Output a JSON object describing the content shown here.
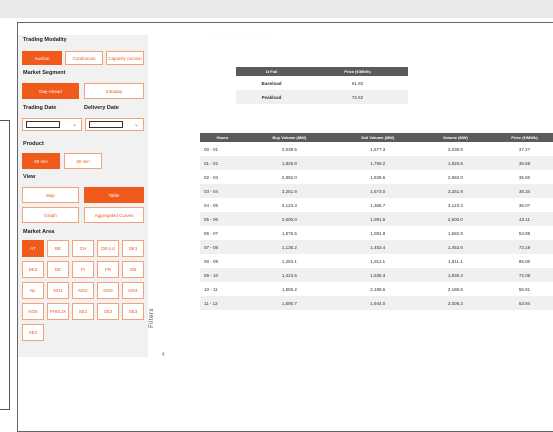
{
  "sidebar": {
    "trading_modality_label": "Trading Modality",
    "modality_buttons": [
      "Auction",
      "Continuous",
      "Capacity Auction"
    ],
    "market_segment_label": "Market Segment",
    "segment_buttons": [
      "Day-Ahead",
      "Intraday"
    ],
    "trading_date_label": "Trading Date",
    "delivery_date_label": "Delivery Date",
    "product_label": "Product",
    "product_buttons": [
      "60 min",
      "30 min"
    ],
    "view_label": "View",
    "view_buttons": [
      "Map",
      "Table",
      "Graph",
      "Aggregated Curves"
    ],
    "market_area_label": "Market Area",
    "market_areas": [
      [
        "AT",
        "BE",
        "CH",
        "DE-LU",
        "DK1"
      ],
      [
        "DK2",
        "EE",
        "FI",
        "FR",
        "GB"
      ],
      [
        "NL",
        "NO1",
        "NO2",
        "NO3",
        "NO4"
      ],
      [
        "NO5",
        "PHELIX",
        "SE1",
        "SE2",
        "SE3"
      ],
      [
        "SE4"
      ]
    ]
  },
  "filters_label": "Filters",
  "faint_heading": "· · · · · · · · ·",
  "summary_table": {
    "headers": [
      "1t Full",
      "Price (€/MWh)"
    ],
    "rows": [
      [
        "Baseload",
        "61.92"
      ],
      [
        "Peakload",
        "72.62"
      ]
    ]
  },
  "hourly_table": {
    "headers": [
      "Hours",
      "Buy Volume (MW)",
      "Sell Volume (MW)",
      "Volume (MW)",
      "Price (€/MWh)"
    ],
    "rows": [
      [
        "00 - 01",
        "2,038.5",
        "1,677.3",
        "2,038.5",
        "37.27"
      ],
      [
        "01 - 02",
        "1,826.8",
        "1,759.2",
        "1,826.8",
        "35.69"
      ],
      [
        "02 - 03",
        "2,882.0",
        "1,839.6",
        "2,882.0",
        "35.60"
      ],
      [
        "03 - 04",
        "3,251.9",
        "1,673.0",
        "3,251.9",
        "35.34"
      ],
      [
        "04 - 05",
        "3,123.3",
        "1,366.7",
        "3,123.3",
        "36.07"
      ],
      [
        "05 - 06",
        "2,600.0",
        "1,091.5",
        "2,600.0",
        "43.11"
      ],
      [
        "06 - 07",
        "1,575.5",
        "1,081.9",
        "1,692.9",
        "53.98"
      ],
      [
        "07 - 08",
        "1,136.2",
        "1,453.4",
        "1,453.6",
        "73.19"
      ],
      [
        "08 - 09",
        "1,283.1",
        "1,911.1",
        "1,911.1",
        "85.00"
      ],
      [
        "09 - 10",
        "1,423.6",
        "1,938.3",
        "1,938.3",
        "72.09"
      ],
      [
        "10 - 11",
        "1,556.2",
        "2,189.6",
        "2,189.6",
        "55.91"
      ],
      [
        "11 - 12",
        "1,590.7",
        "1,944.0",
        "2,009.3",
        "53.94"
      ]
    ]
  }
}
